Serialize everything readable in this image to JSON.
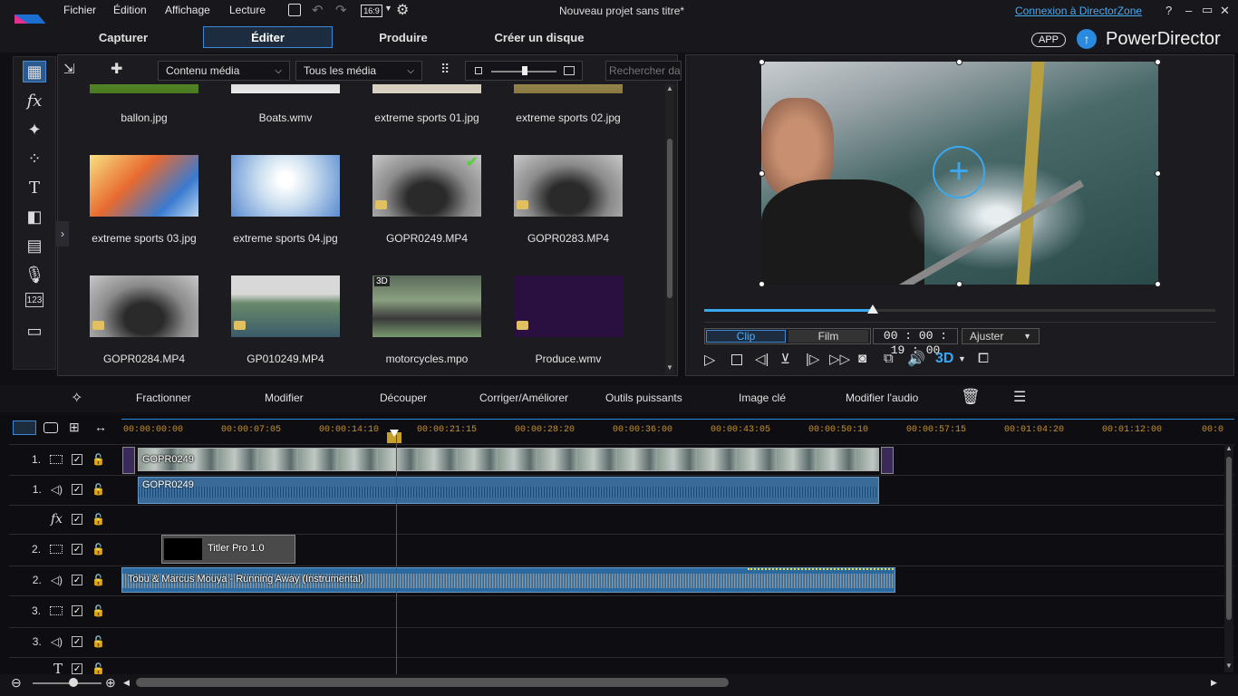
{
  "menu": {
    "items": [
      "Fichier",
      "Édition",
      "Affichage",
      "Lecture"
    ],
    "aspect": "16:9",
    "project_title": "Nouveau projet sans titre*",
    "login_link": "Connexion à DirectorZone",
    "window_controls": [
      "?",
      "–",
      "▭",
      "✕"
    ]
  },
  "tabs": {
    "capture": "Capturer",
    "edit": "Éditer",
    "produce": "Produire",
    "disc": "Créer un disque"
  },
  "brand": {
    "app_badge": "APP",
    "name": "PowerDirector"
  },
  "library": {
    "content_filter": "Contenu média",
    "type_filter": "Tous les média",
    "search_placeholder": "Rechercher dans la bibliothèque",
    "items": [
      {
        "label": "ballon.jpg"
      },
      {
        "label": "Boats.wmv"
      },
      {
        "label": "extreme sports 01.jpg"
      },
      {
        "label": "extreme sports 02.jpg"
      },
      {
        "label": "extreme sports 03.jpg"
      },
      {
        "label": "extreme sports 04.jpg"
      },
      {
        "label": "GOPR0249.MP4"
      },
      {
        "label": "GOPR0283.MP4"
      },
      {
        "label": "GOPR0284.MP4"
      },
      {
        "label": "GP010249.MP4"
      },
      {
        "label": "motorcycles.mpo"
      },
      {
        "label": "Produce.wmv"
      }
    ],
    "badge_3d": "3D"
  },
  "preview": {
    "clip_tab": "Clip",
    "film_tab": "Film",
    "timecode": "00 : 00 : 19 : 00",
    "fit": "Ajuster",
    "mode_3d": "3D",
    "scrubber_position": 0.33
  },
  "edit_tools": [
    "Fractionner",
    "Modifier",
    "Découper",
    "Corriger/Améliorer",
    "Outils puissants",
    "Image clé",
    "Modifier l'audio"
  ],
  "ruler": [
    "00:00:00:00",
    "00:00:07:05",
    "00:00:14:10",
    "00:00:21:15",
    "00:00:28:20",
    "00:00:36:00",
    "00:00:43:05",
    "00:00:50:10",
    "00:00:57:15",
    "00:01:04:20",
    "00:01:12:00",
    "00:0"
  ],
  "tracks": [
    {
      "num": "1.",
      "type": "video"
    },
    {
      "num": "1.",
      "type": "audio"
    },
    {
      "num": "",
      "type": "fx",
      "label": "fx"
    },
    {
      "num": "2.",
      "type": "video"
    },
    {
      "num": "2.",
      "type": "audio"
    },
    {
      "num": "3.",
      "type": "video"
    },
    {
      "num": "3.",
      "type": "audio"
    },
    {
      "num": "",
      "type": "title",
      "label": "T"
    }
  ],
  "clips": {
    "video1": "GOPR0249",
    "audio1": "GOPR0249",
    "title": "Titler Pro 1.0",
    "music": "Tobu & Marcus Mouya - Running Away (Instrumental)"
  },
  "colors": {
    "accent": "#3a8ad8",
    "playhead": "#d02020",
    "video_clip": "#4a7aa8",
    "audio_clip": "#2a6aa0"
  }
}
